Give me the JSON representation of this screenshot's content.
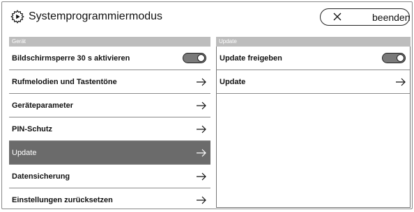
{
  "header": {
    "title": "Systemprogrammiermodus",
    "exit_label": "beenden"
  },
  "left": {
    "section": "Gerät",
    "items": [
      {
        "label": "Bildschirmsperre 30 s aktivieren",
        "control": "toggle",
        "toggle_on": false
      },
      {
        "label": "Rufmelodien und Tastentöne",
        "control": "arrow"
      },
      {
        "label": "Geräteparameter",
        "control": "arrow"
      },
      {
        "label": "PIN-Schutz",
        "control": "arrow"
      },
      {
        "label": "Update",
        "control": "arrow",
        "selected": true
      },
      {
        "label": "Datensicherung",
        "control": "arrow"
      },
      {
        "label": "Einstellungen zurücksetzen",
        "control": "arrow"
      }
    ]
  },
  "right": {
    "section": "Update",
    "items": [
      {
        "label": "Update freigeben",
        "control": "toggle",
        "toggle_on": false
      },
      {
        "label": "Update",
        "control": "arrow"
      }
    ]
  },
  "colors": {
    "section_bg": "#bdbdbd",
    "selected_bg": "#6b6b6b",
    "toggle_bg": "#7a7a7a"
  }
}
